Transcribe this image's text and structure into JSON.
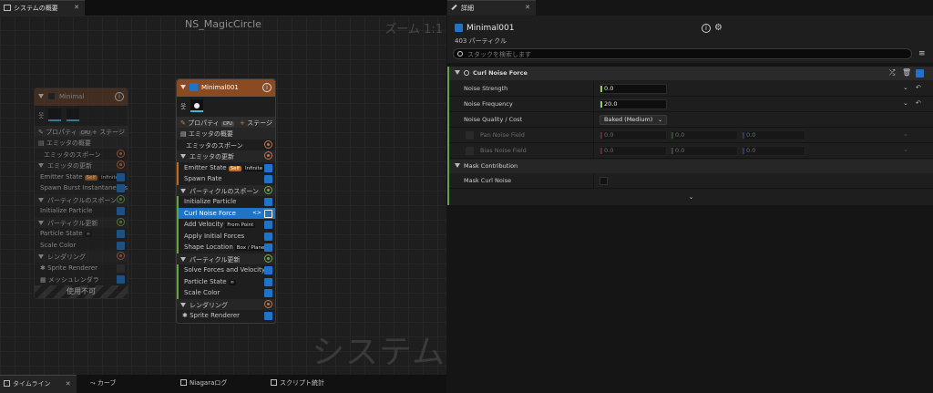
{
  "left_tab": {
    "title": "システムの概要",
    "close": "✕"
  },
  "graph": {
    "title": "NS_MagicCircle",
    "zoom": "ズーム 1:1",
    "watermark": "システム"
  },
  "disabled_emitter": {
    "name": "Minimal",
    "properties": "プロパティ",
    "cpu": "CPU",
    "stage": "ステージ",
    "summary": "エミッタの概要",
    "spawn": "エミッタのスポーン",
    "update": "エミッタの更新",
    "emitter_state": "Emitter State",
    "self_tag": "Self",
    "infinite_tag": "Infinite",
    "spawn_burst": "Spawn Burst Instantaneous",
    "particle_spawn": "パーティクルのスポーン",
    "init_particle": "Initialize Particle",
    "particle_update": "パーティクル更新",
    "particle_state": "Particle State",
    "scale_color": "Scale Color",
    "rendering": "レンダリング",
    "sprite_renderer": "Sprite Renderer",
    "mesh_renderer": "メッシュレンダラ",
    "disabled_label": "使用不可"
  },
  "active_emitter": {
    "name": "Minimal001",
    "properties": "プロパティ",
    "cpu": "CPU",
    "stage": "ステージ",
    "summary": "エミッタの概要",
    "spawn": "エミッタのスポーン",
    "update": "エミッタの更新",
    "emitter_state": "Emitter State",
    "self_tag": "Self",
    "infinite_tag": "Infinite",
    "spawn_rate": "Spawn Rate",
    "particle_spawn": "パーティクルのスポーン",
    "init_particle": "Initialize Particle",
    "curl_noise": "Curl Noise Force",
    "curl_tag": "<>",
    "add_velocity": "Add Velocity",
    "from_point": "From Point",
    "apply_forces": "Apply Initial Forces",
    "shape_location": "Shape Location",
    "box_plane": "Box / Plane",
    "particle_update": "パーティクル更新",
    "solve_forces": "Solve Forces and Velocity",
    "particle_state": "Particle State",
    "scale_color": "Scale Color",
    "rendering": "レンダリング",
    "sprite_renderer": "Sprite Renderer"
  },
  "bottom_tabs": [
    {
      "label": "タイムライン"
    },
    {
      "label": "カーブ"
    },
    {
      "label": "Niagaraログ"
    },
    {
      "label": "スクリプト統計"
    }
  ],
  "details": {
    "tab_title": "詳細",
    "close": "✕",
    "emitter_name": "Minimal001",
    "particle_count": "403 パーティクル",
    "search_placeholder": "スタックを検索します",
    "module_title": "Curl Noise Force",
    "noise_strength_label": "Noise Strength",
    "noise_strength_value": "0.0",
    "noise_frequency_label": "Noise Frequency",
    "noise_frequency_value": "20.0",
    "quality_label": "Noise Quality / Cost",
    "quality_value": "Baked (Medium)",
    "pan_label": "Pan Noise Field",
    "pan_x": "0.0",
    "pan_y": "0.0",
    "pan_z": "0.0",
    "bias_label": "Bias Noise Field",
    "bias_x": "0.0",
    "bias_y": "0.0",
    "bias_z": "0.0",
    "mask_section": "Mask Contribution",
    "mask_label": "Mask Curl Noise"
  },
  "colors": {
    "accent_blue": "#1d74c9",
    "emitter_header": "#8a4a22",
    "module_green": "#5fa63d",
    "value_green": "#8ed04a"
  }
}
